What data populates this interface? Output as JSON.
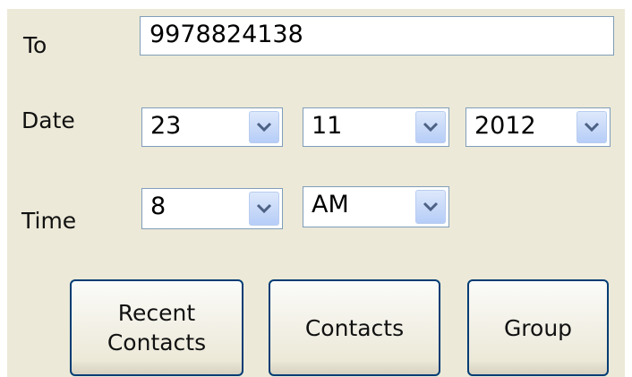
{
  "form": {
    "to_label": "To",
    "to_value": "9978824138",
    "date_label": "Date",
    "day_value": "23",
    "month_value": "11",
    "year_value": "2012",
    "time_label": "Time",
    "hour_value": "8",
    "ampm_value": "AM"
  },
  "buttons": {
    "recent_line1": "Recent",
    "recent_line2": "Contacts",
    "contacts": "Contacts",
    "group": "Group"
  },
  "icons": {
    "dropdown": "chevron-down-icon"
  },
  "colors": {
    "panel_bg": "#ece9d8",
    "border": "#7f9db9",
    "button_border": "#003c74",
    "arrow": "#4d6185"
  }
}
